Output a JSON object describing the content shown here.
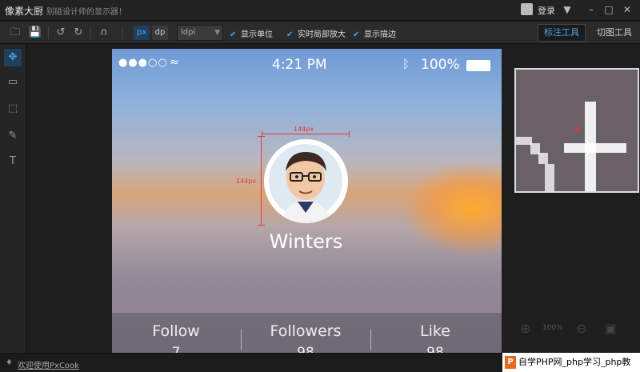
{
  "app": {
    "title": "像素大厨",
    "slogan": "别碰设计师的显示器！",
    "login": "登录"
  },
  "window": {
    "minimize": "–",
    "maximize": "□",
    "close": "✕",
    "menu": "▼"
  },
  "toolbar": {
    "units": [
      "px",
      "dp"
    ],
    "dpi_value": "ldpi",
    "checks": [
      {
        "label": "显示单位",
        "checked": true
      },
      {
        "label": "实时局部放大",
        "checked": true
      },
      {
        "label": "显示描边",
        "checked": true
      }
    ],
    "tab_mark": "标注工具",
    "tab_slice": "切图工具"
  },
  "phone": {
    "time": "4:21 PM",
    "signal": "●●●○○",
    "battery_text": "100%",
    "name": "Winters",
    "stats": [
      {
        "label": "Follow",
        "value": "7"
      },
      {
        "label": "Followers",
        "value": "98"
      },
      {
        "label": "Like",
        "value": "98"
      }
    ]
  },
  "measure": {
    "width_label": "144px",
    "height_label": "144px"
  },
  "zoom": {
    "level": "100%"
  },
  "footer": {
    "link": "欢迎使用PxCook"
  },
  "watermark": {
    "text": "自学PHP网_php学习_php教",
    "logo": "P"
  },
  "colors": {
    "accent": "#4ea3e8",
    "measure": "#e33333"
  }
}
